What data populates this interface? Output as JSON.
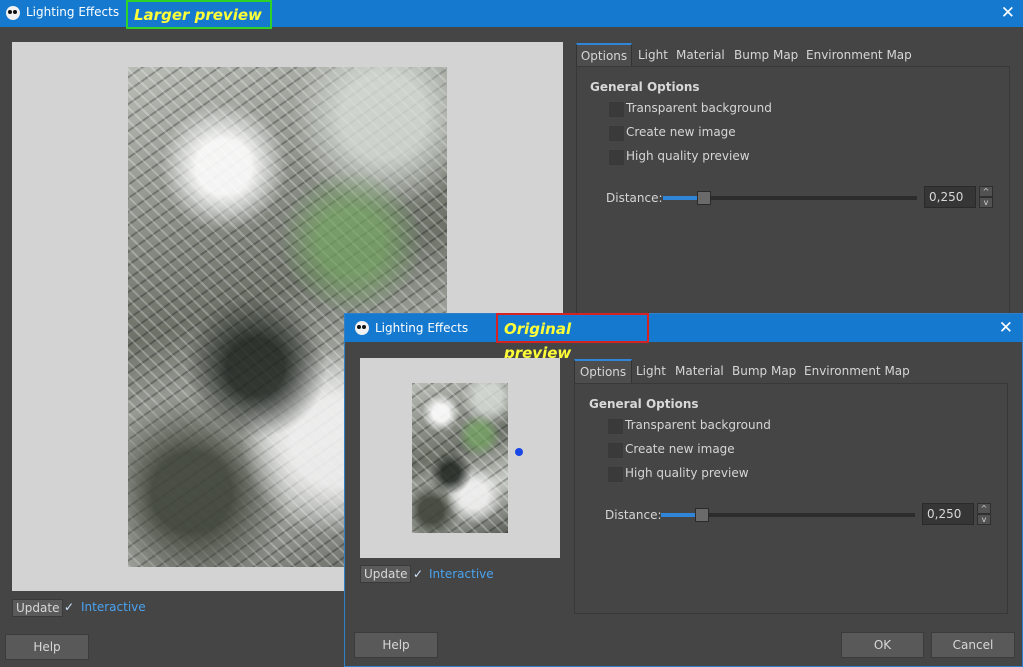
{
  "colors": {
    "titlebar": "#1479cf",
    "accent": "#2f86d9",
    "background": "#454545",
    "callout_text": "#ffff38",
    "callout_green_border": "#2fd12b",
    "callout_red_border": "#d62222",
    "light_dot": "#1a47e8"
  },
  "back_dialog": {
    "title": "Lighting Effects",
    "callout": "Larger preview",
    "icons": {
      "app": "gimp-icon",
      "close": "close-icon"
    },
    "close_glyph": "✕",
    "update_label": "Update",
    "interactive_label": "Interactive",
    "interactive_checked": true,
    "check_glyph": "✓",
    "tabs": [
      "Options",
      "Light",
      "Material",
      "Bump Map",
      "Environment Map"
    ],
    "active_tab": "Options",
    "group_title": "General Options",
    "checkboxes": [
      "Transparent background",
      "Create new image",
      "High quality preview"
    ],
    "distance_label": "Distance:",
    "distance_value": "0,250",
    "distance_fraction": 0.25,
    "spin_up": "^",
    "spin_down": "v",
    "help_label": "Help"
  },
  "front_dialog": {
    "title": "Lighting Effects",
    "callout": "Original preview",
    "icons": {
      "app": "gimp-icon",
      "close": "close-icon"
    },
    "close_glyph": "✕",
    "update_label": "Update",
    "interactive_label": "Interactive",
    "interactive_checked": true,
    "check_glyph": "✓",
    "tabs": [
      "Options",
      "Light",
      "Material",
      "Bump Map",
      "Environment Map"
    ],
    "active_tab": "Options",
    "group_title": "General Options",
    "checkboxes": [
      "Transparent background",
      "Create new image",
      "High quality preview"
    ],
    "distance_label": "Distance:",
    "distance_value": "0,250",
    "distance_fraction": 0.25,
    "spin_up": "^",
    "spin_down": "v",
    "help_label": "Help",
    "ok_label": "OK",
    "cancel_label": "Cancel"
  }
}
